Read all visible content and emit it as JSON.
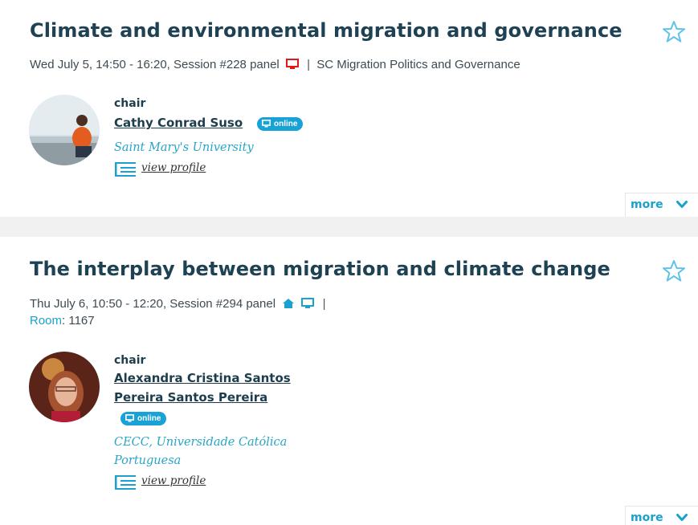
{
  "sessions": [
    {
      "title": "Climate and environmental migration and governance",
      "when": "Wed July 5, 14:50 - 16:20, Session #228 panel",
      "separator": "|",
      "stream": "SC Migration Politics and Governance",
      "chair": {
        "role": "chair",
        "name_lines": [
          "Cathy Conrad Suso"
        ],
        "badge": "online",
        "affiliation_lines": [
          "Saint Mary's University"
        ],
        "profile_link": "view profile"
      },
      "more_label": "more"
    },
    {
      "title": "The interplay between migration and climate change",
      "when": "Thu July 6, 10:50 - 12:20, Session #294 panel",
      "separator": "|",
      "room_label": "Room",
      "room_value": ": 1167",
      "chair": {
        "role": "chair",
        "name_lines": [
          "Alexandra Cristina Santos",
          "Pereira Santos Pereira"
        ],
        "badge": "online",
        "affiliation_lines": [
          "CECC, Universidade Católica",
          "Portuguesa"
        ],
        "profile_link": "view profile"
      },
      "more_label": "more"
    }
  ],
  "icons": {
    "favorite": "star-outline-icon",
    "online_presentation": "monitor-icon",
    "in_person": "house-icon",
    "profile": "profile-card-icon",
    "expand": "chevron-down-icon"
  },
  "colors": {
    "title": "#1e4253",
    "accent": "#19a2d6",
    "monitor_red": "#e01818",
    "band": "#f1f1f1"
  }
}
